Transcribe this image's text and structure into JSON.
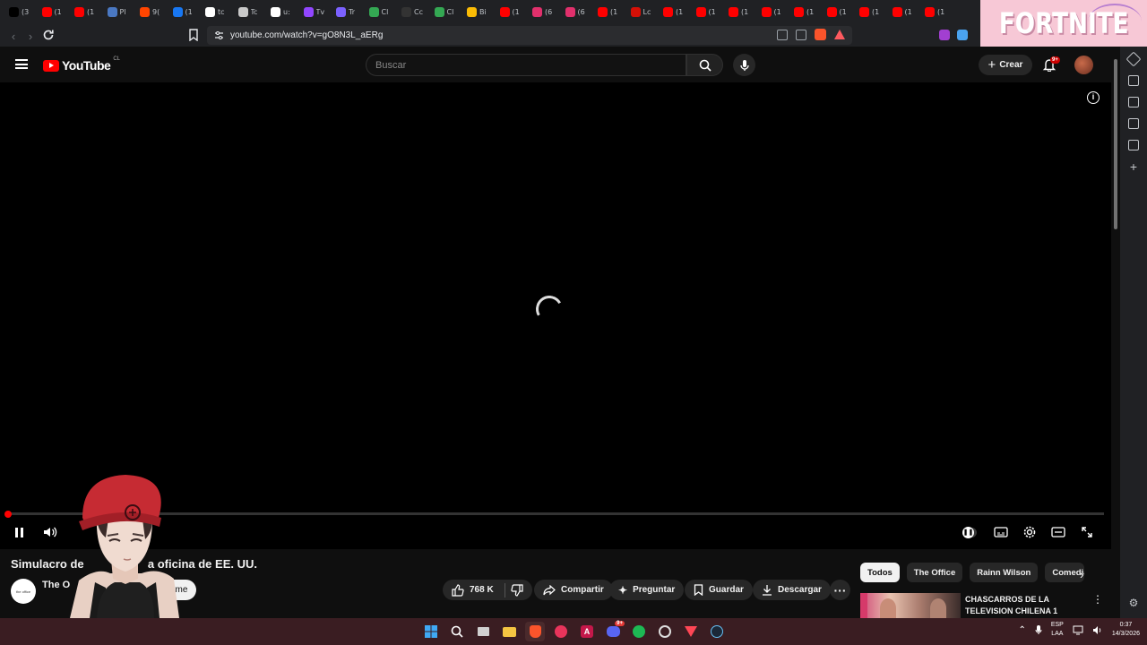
{
  "browser": {
    "tabs": [
      {
        "icon": "x-icon",
        "label": "(3",
        "color": "#000000"
      },
      {
        "icon": "youtube-icon",
        "label": "(1",
        "color": "#ff0000"
      },
      {
        "icon": "youtube-icon",
        "label": "(1",
        "color": "#ff0000"
      },
      {
        "icon": "perplexity-icon",
        "label": "Pl",
        "color": "#4a78c2"
      },
      {
        "icon": "reddit-icon",
        "label": "9(",
        "color": "#ff4500"
      },
      {
        "icon": "facebook-icon",
        "label": "(1",
        "color": "#1877f2"
      },
      {
        "icon": "google-icon",
        "label": "tc",
        "color": "#ffffff"
      },
      {
        "icon": "cloud-icon",
        "label": "Tc",
        "color": "#c9c9c9"
      },
      {
        "icon": "google-icon",
        "label": "u:",
        "color": "#ffffff"
      },
      {
        "icon": "twitch-icon",
        "label": "Tv",
        "color": "#9146ff"
      },
      {
        "icon": "t-icon",
        "label": "Tr",
        "color": "#7b61ff"
      },
      {
        "icon": "chrome-icon",
        "label": "Cl",
        "color": "#34a853"
      },
      {
        "icon": "github-icon",
        "label": "Cc",
        "color": "#333333"
      },
      {
        "icon": "chrome-icon",
        "label": "Cl",
        "color": "#34a853"
      },
      {
        "icon": "chrome-icon",
        "label": "Bi",
        "color": "#fbbc05"
      },
      {
        "icon": "youtube-icon",
        "label": "(1",
        "color": "#ff0000"
      },
      {
        "icon": "instagram-icon",
        "label": "(6",
        "color": "#e1306c"
      },
      {
        "icon": "instagram-icon",
        "label": "(6",
        "color": "#e1306c"
      },
      {
        "icon": "youtube-icon",
        "label": "(1",
        "color": "#ff0000"
      },
      {
        "icon": "lastfm-icon",
        "label": "Lc",
        "color": "#d51007"
      },
      {
        "icon": "youtube-icon",
        "label": "(1",
        "color": "#ff0000"
      },
      {
        "icon": "youtube-icon",
        "label": "(1",
        "color": "#ff0000"
      },
      {
        "icon": "youtube-icon",
        "label": "(1",
        "color": "#ff0000"
      },
      {
        "icon": "youtube-icon",
        "label": "(1",
        "color": "#ff0000"
      },
      {
        "icon": "youtube-icon",
        "label": "(1",
        "color": "#ff0000"
      },
      {
        "icon": "youtube-icon",
        "label": "(1",
        "color": "#ff0000"
      },
      {
        "icon": "youtube-icon",
        "label": "(1",
        "color": "#ff0000"
      },
      {
        "icon": "youtube-icon",
        "label": "(1",
        "color": "#ff0000"
      },
      {
        "icon": "youtube-icon",
        "label": "(1",
        "color": "#ff0000"
      }
    ],
    "url": "youtube.com/watch?v=gO8N3L_aERg",
    "ad_banner": "FORTNITE"
  },
  "youtube": {
    "logo_text": "YouTube",
    "logo_country": "CL",
    "search_placeholder": "Buscar",
    "create_label": "Crear",
    "notifications_badge": "9+"
  },
  "player": {
    "progress_fraction": 0.0
  },
  "video": {
    "title_left": "Simulacro de",
    "title_right": "a oficina de EE. UU.",
    "channel_avatar_text": "the office",
    "channel_name": "The O",
    "subscribe_label": "Suscribirme",
    "like_count": "768 K",
    "share_label": "Compartir",
    "ask_label": "Preguntar",
    "save_label": "Guardar",
    "download_label": "Descargar"
  },
  "chips": [
    {
      "label": "Todos",
      "active": true
    },
    {
      "label": "The Office",
      "active": false
    },
    {
      "label": "Rainn Wilson",
      "active": false
    },
    {
      "label": "Comedia",
      "active": false
    }
  ],
  "recommendation": {
    "title": "CHASCARROS DE LA TELEVISION CHILENA 1"
  },
  "taskbar": {
    "lang_top": "ESP",
    "lang_bottom": "LAA",
    "time": "0:37",
    "date": "14/3/2026",
    "discord_badge": "9+"
  }
}
